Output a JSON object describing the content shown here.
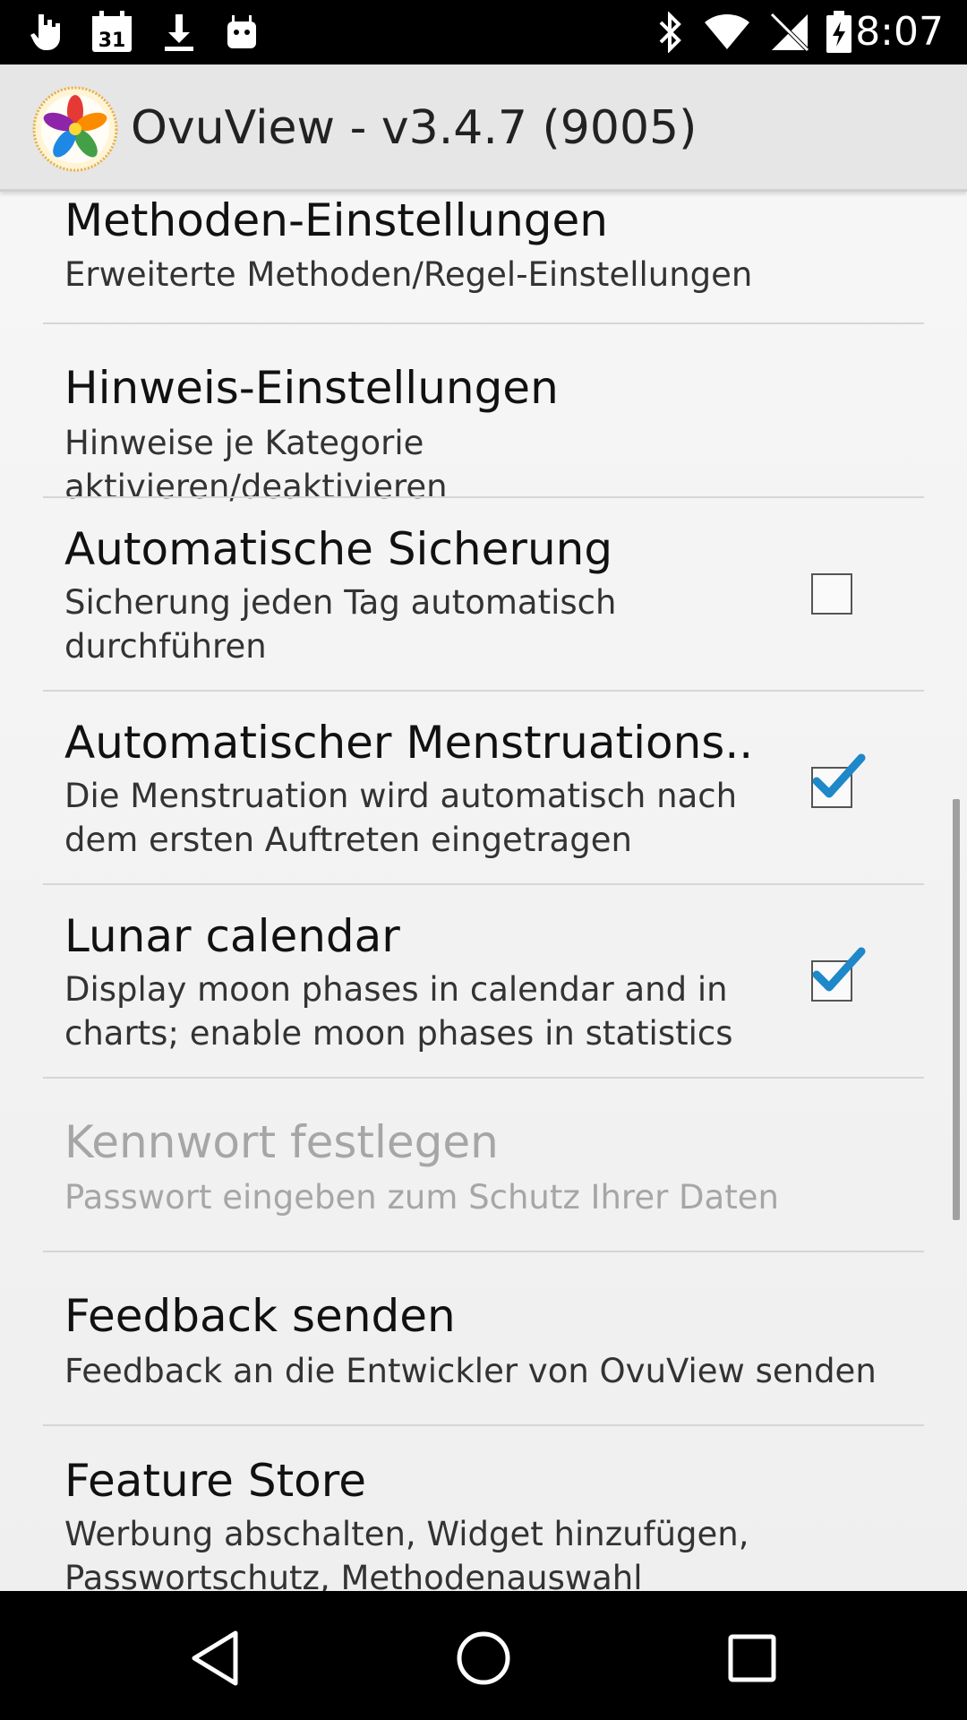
{
  "status_bar": {
    "time": "8:07",
    "calendar_day": "31",
    "left_icons": [
      "hand-notification-icon",
      "calendar-icon",
      "download-icon",
      "android-icon"
    ],
    "right_icons": [
      "bluetooth-icon",
      "wifi-icon",
      "no-signal-icon",
      "battery-charging-icon"
    ]
  },
  "app_bar": {
    "title": "OvuView - v3.4.7 (9005)",
    "logo_icon": "ovuview-logo"
  },
  "preferences": [
    {
      "title": "Methoden-Einstellungen",
      "summary": "Erweiterte Methoden/Regel-Einstellungen",
      "enabled": true,
      "checkbox": null
    },
    {
      "title": "Hinweis-Einstellungen",
      "summary": "Hinweise je Kategorie aktivieren/deaktivieren",
      "enabled": true,
      "checkbox": null
    },
    {
      "title": "Automatische Sicherung",
      "summary": "Sicherung jeden Tag automatisch durchführen",
      "enabled": true,
      "checkbox": false
    },
    {
      "title": "Automatischer Menstruations..",
      "summary": "Die Menstruation wird automatisch nach dem ersten Auftreten eingetragen",
      "enabled": true,
      "checkbox": true
    },
    {
      "title": "Lunar calendar",
      "summary": "Display moon phases in calendar and in charts; enable moon phases in statistics",
      "enabled": true,
      "checkbox": true
    },
    {
      "title": "Kennwort festlegen",
      "summary": "Passwort eingeben zum Schutz Ihrer Daten",
      "enabled": false,
      "checkbox": null
    },
    {
      "title": "Feedback senden",
      "summary": "Feedback an die Entwickler von OvuView senden",
      "enabled": true,
      "checkbox": null
    },
    {
      "title": "Feature Store",
      "summary": "Werbung abschalten, Widget hinzufügen, Passwortschutz, Methodenauswahl",
      "enabled": true,
      "checkbox": null
    }
  ],
  "colors": {
    "checkbox_check": "#1e88c8",
    "disabled_text": "#a6a6a6",
    "app_bar_bg": "#e6e6e6"
  },
  "nav_bar": {
    "buttons": [
      "back-icon",
      "home-icon",
      "recents-icon"
    ]
  }
}
